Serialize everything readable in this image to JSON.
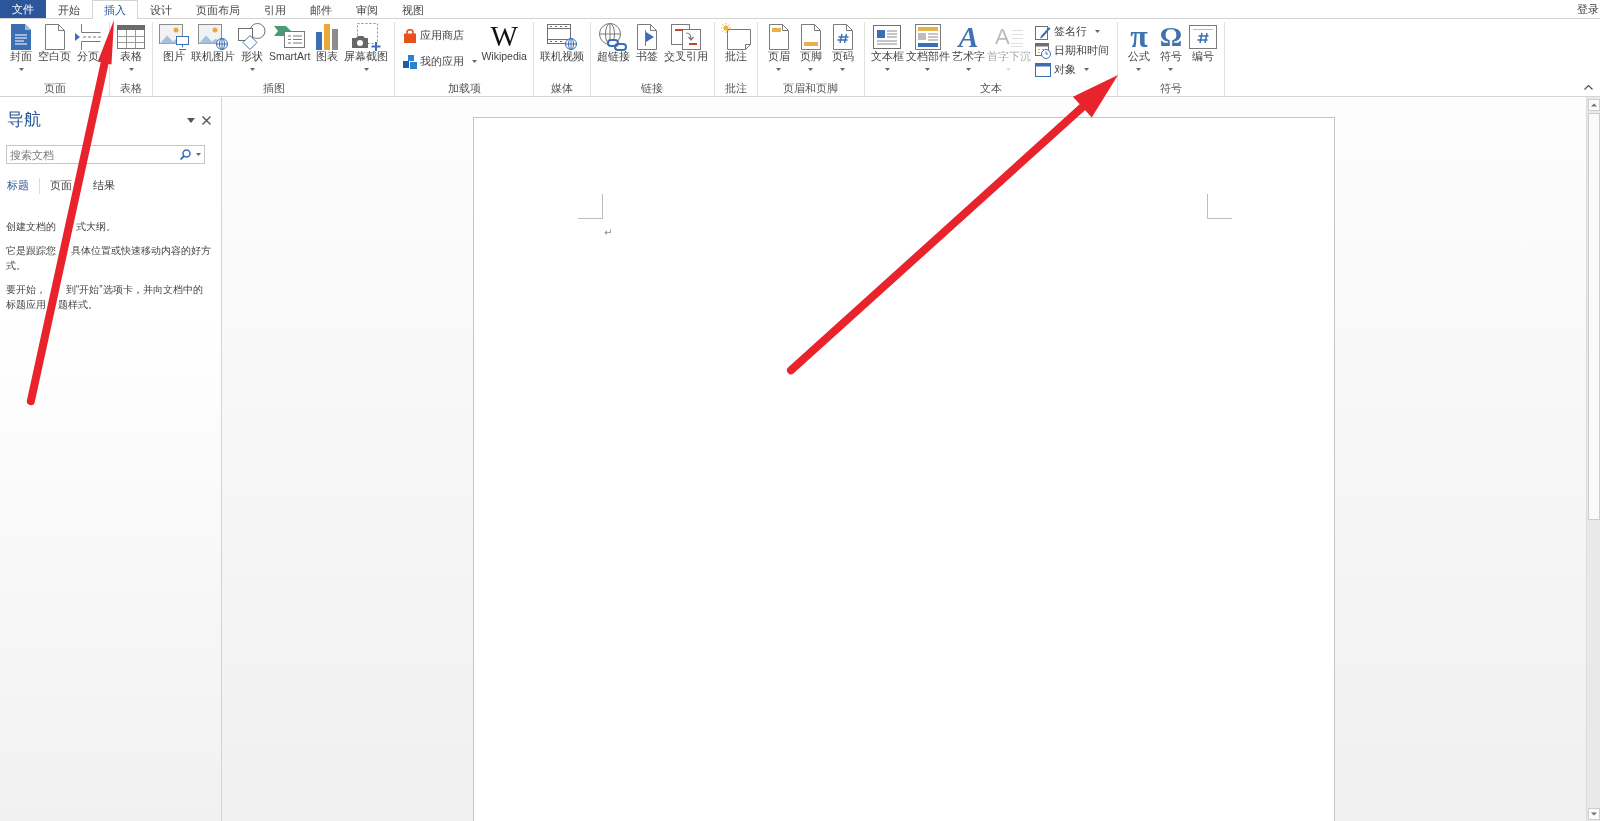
{
  "tabs": [
    {
      "label": "文件",
      "kind": "file",
      "selected": false
    },
    {
      "label": "开始",
      "kind": "ribbon",
      "selected": false
    },
    {
      "label": "插入",
      "kind": "ribbon",
      "selected": true
    },
    {
      "label": "设计",
      "kind": "ribbon",
      "selected": false
    },
    {
      "label": "页面布局",
      "kind": "ribbon",
      "selected": false
    },
    {
      "label": "引用",
      "kind": "ribbon",
      "selected": false
    },
    {
      "label": "邮件",
      "kind": "ribbon",
      "selected": false
    },
    {
      "label": "审阅",
      "kind": "ribbon",
      "selected": false
    },
    {
      "label": "视图",
      "kind": "ribbon",
      "selected": false
    }
  ],
  "account": {
    "label": "登录"
  },
  "ribbon": {
    "groups": [
      {
        "label": "页面",
        "items": [
          {
            "kind": "large",
            "label": "封面",
            "dropdown": true,
            "disabled": false
          },
          {
            "kind": "large",
            "label": "空白页",
            "dropdown": false,
            "disabled": false
          },
          {
            "kind": "large",
            "label": "分页",
            "dropdown": false,
            "disabled": false
          }
        ]
      },
      {
        "label": "表格",
        "items": [
          {
            "kind": "large",
            "label": "表格",
            "dropdown": true,
            "disabled": false
          }
        ]
      },
      {
        "label": "插图",
        "items": [
          {
            "kind": "large",
            "label": "图片",
            "dropdown": false,
            "disabled": false
          },
          {
            "kind": "large",
            "label": "联机图片",
            "dropdown": false,
            "disabled": false
          },
          {
            "kind": "large",
            "label": "形状",
            "dropdown": true,
            "disabled": false
          },
          {
            "kind": "large",
            "label": "SmartArt",
            "dropdown": false,
            "disabled": false
          },
          {
            "kind": "large",
            "label": "图表",
            "dropdown": false,
            "disabled": false
          },
          {
            "kind": "large",
            "label": "屏幕截图",
            "dropdown": true,
            "disabled": false
          }
        ]
      },
      {
        "label": "加载项",
        "items": [
          {
            "kind": "stack",
            "items": [
              {
                "kind": "small",
                "label": "应用商店",
                "dropdown": false,
                "disabled": false
              },
              {
                "kind": "small",
                "label": "我的应用",
                "dropdown": true,
                "disabled": false
              }
            ]
          },
          {
            "kind": "large",
            "label": "Wikipedia",
            "glyph": "W",
            "dropdown": false,
            "disabled": false
          }
        ]
      },
      {
        "label": "媒体",
        "items": [
          {
            "kind": "large",
            "label": "联机视频",
            "dropdown": false,
            "disabled": false
          }
        ]
      },
      {
        "label": "链接",
        "items": [
          {
            "kind": "large",
            "label": "超链接",
            "dropdown": false,
            "disabled": false
          },
          {
            "kind": "large",
            "label": "书签",
            "dropdown": false,
            "disabled": false
          },
          {
            "kind": "large",
            "label": "交叉引用",
            "dropdown": false,
            "disabled": false
          }
        ]
      },
      {
        "label": "批注",
        "items": [
          {
            "kind": "large",
            "label": "批注",
            "dropdown": false,
            "disabled": false
          }
        ]
      },
      {
        "label": "页眉和页脚",
        "items": [
          {
            "kind": "large",
            "label": "页眉",
            "dropdown": true,
            "disabled": false
          },
          {
            "kind": "large",
            "label": "页脚",
            "dropdown": true,
            "disabled": false
          },
          {
            "kind": "large",
            "label": "页码",
            "dropdown": true,
            "disabled": false
          }
        ]
      },
      {
        "label": "文本",
        "items": [
          {
            "kind": "large",
            "label": "文本框",
            "dropdown": true,
            "disabled": false
          },
          {
            "kind": "large",
            "label": "文档部件",
            "dropdown": true,
            "disabled": false
          },
          {
            "kind": "large",
            "label": "艺术字",
            "glyph": "A",
            "dropdown": true,
            "disabled": false
          },
          {
            "kind": "large",
            "label": "首字下沉",
            "glyph": "A",
            "dropdown": true,
            "disabled": true
          },
          {
            "kind": "stack",
            "items": [
              {
                "kind": "small",
                "label": "签名行",
                "dropdown": true,
                "disabled": false
              },
              {
                "kind": "small",
                "label": "日期和时间",
                "dropdown": false,
                "disabled": false
              },
              {
                "kind": "small",
                "label": "对象",
                "dropdown": true,
                "disabled": false
              }
            ]
          }
        ]
      },
      {
        "label": "符号",
        "items": [
          {
            "kind": "large",
            "label": "公式",
            "glyph": "π",
            "dropdown": true,
            "disabled": false
          },
          {
            "kind": "large",
            "label": "符号",
            "glyph": "Ω",
            "dropdown": true,
            "disabled": false
          },
          {
            "kind": "large",
            "label": "编号",
            "dropdown": false,
            "disabled": false
          }
        ]
      }
    ]
  },
  "navigation": {
    "title": "导航",
    "search": {
      "placeholder": "搜索文档"
    },
    "tabs": [
      {
        "label": "标题",
        "selected": true
      },
      {
        "label": "页面",
        "selected": false
      },
      {
        "label": "结果",
        "selected": false
      }
    ],
    "paragraphs": [
      {
        "lines": [
          [
            "创建文档的",
            "式大纲。"
          ]
        ]
      },
      {
        "lines": [
          [
            "它是跟踪您",
            "具体位置或快速移动内容的好方"
          ],
          [
            "式。"
          ]
        ]
      },
      {
        "lines": [
          [
            "要开始，",
            "到“开始”选项卡，并向文档中的"
          ],
          [
            "标题应用",
            "题样式。"
          ]
        ]
      }
    ]
  },
  "document": {
    "paragraph_mark": "↵"
  },
  "annotations": [
    {
      "kind": "arrow"
    },
    {
      "kind": "arrow"
    }
  ]
}
